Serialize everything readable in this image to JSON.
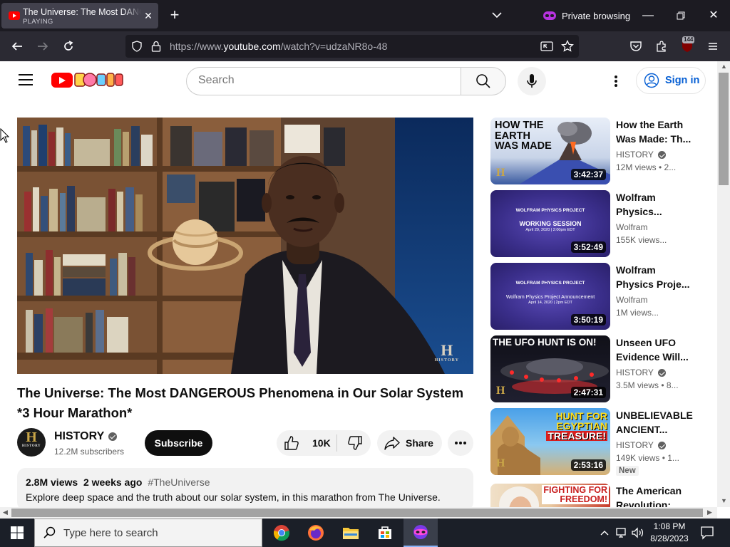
{
  "browser": {
    "tab_title": "The Universe: The Most DANGEROUS Phenomena in Our Solar System *3 Hour Marathon*",
    "tab_status": "PLAYING",
    "private_label": "Private browsing",
    "url_prefix": "https://www.",
    "url_domain": "youtube.com",
    "url_path": "/watch?v=udzaNR8o-48",
    "extension_badge": "144"
  },
  "youtube": {
    "search_placeholder": "Search",
    "sign_in": "Sign in",
    "video": {
      "title": "The Universe: The Most DANGEROUS Phenomena in Our Solar System *3 Hour Marathon*",
      "watermark": "H",
      "watermark_text": "HISTORY",
      "channel": "HISTORY",
      "subscribers": "12.2M subscribers",
      "subscribe_label": "Subscribe",
      "likes": "10K",
      "share_label": "Share",
      "views": "2.8M views",
      "age": "2 weeks ago",
      "hashtag": "#TheUniverse",
      "description": "Explore deep space and the truth about our solar system, in this marathon from The Universe."
    },
    "recommendations": [
      {
        "title_l1": "How the Earth",
        "title_l2": "Was Made: Th...",
        "channel": "HISTORY",
        "verified": true,
        "meta": "12M views  • 2...",
        "duration": "3:42:37",
        "thumb_text": [
          "HOW THE",
          "EARTH",
          "WAS MADE"
        ]
      },
      {
        "title_l1": "Wolfram",
        "title_l2": "Physics...",
        "channel": "Wolfram",
        "verified": false,
        "meta": "155K views...",
        "duration": "3:52:49",
        "thumb_text": [
          "WOLFRAM PHYSICS PROJECT",
          "WORKING SESSION",
          "April 29, 2020 | 2:00pm EDT"
        ]
      },
      {
        "title_l1": "Wolfram",
        "title_l2": "Physics Proje...",
        "channel": "Wolfram",
        "verified": false,
        "meta": "1M views...",
        "duration": "3:50:19",
        "thumb_text": [
          "WOLFRAM PHYSICS PROJECT",
          "Wolfram Physics Project Announcement",
          "April 14, 2020 | 2pm EDT"
        ]
      },
      {
        "title_l1": "Unseen UFO",
        "title_l2": "Evidence Will...",
        "channel": "HISTORY",
        "verified": true,
        "meta": "3.5M views  • 8...",
        "duration": "2:47:31",
        "thumb_text": [
          "THE UFO HUNT IS ON!"
        ]
      },
      {
        "title_l1": "UNBELIEVABLE",
        "title_l2": "ANCIENT...",
        "channel": "HISTORY",
        "verified": true,
        "meta": "149K views  • 1...",
        "duration": "2:53:16",
        "thumb_text": [
          "HUNT FOR",
          "EGYPTIAN",
          "TREASURE!"
        ],
        "badge": "New"
      },
      {
        "title_l1": "The American",
        "title_l2": "Revolution:",
        "channel": "",
        "verified": false,
        "meta": "",
        "duration": "",
        "thumb_text": [
          "FIGHTING FOR",
          "FREEDOM!"
        ]
      }
    ]
  },
  "taskbar": {
    "search_placeholder": "Type here to search",
    "time": "1:08 PM",
    "date": "8/28/2023"
  },
  "colors": {
    "browser_dark": "#1c1b22",
    "browser_toolbar": "#2b2a33",
    "youtube_red": "#ff0000",
    "link_blue": "#065fd4",
    "private_purple": "#b833e1"
  }
}
